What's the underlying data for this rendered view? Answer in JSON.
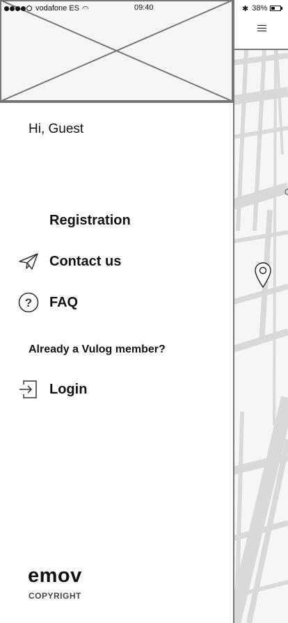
{
  "status_bar": {
    "carrier": "vodafone ES",
    "time": "09:40",
    "battery": "38%"
  },
  "drawer": {
    "greeting": "Hi, Guest",
    "items": {
      "registration": "Registration",
      "contact": "Contact us",
      "faq": "FAQ",
      "login": "Login"
    },
    "member_question": "Already a Vulog member?",
    "brand": "emov",
    "copyright": "COPYRIGHT"
  },
  "icons": {
    "menu": "hamburger-icon",
    "contact": "paper-plane-icon",
    "faq": "question-circle-icon",
    "login": "login-arrow-icon",
    "pin": "location-pin-icon",
    "header": "image-placeholder-icon"
  },
  "colors": {
    "placeholder_bg": "#f6f6f6",
    "border": "#777777",
    "map_road": "#d9d9d9"
  }
}
